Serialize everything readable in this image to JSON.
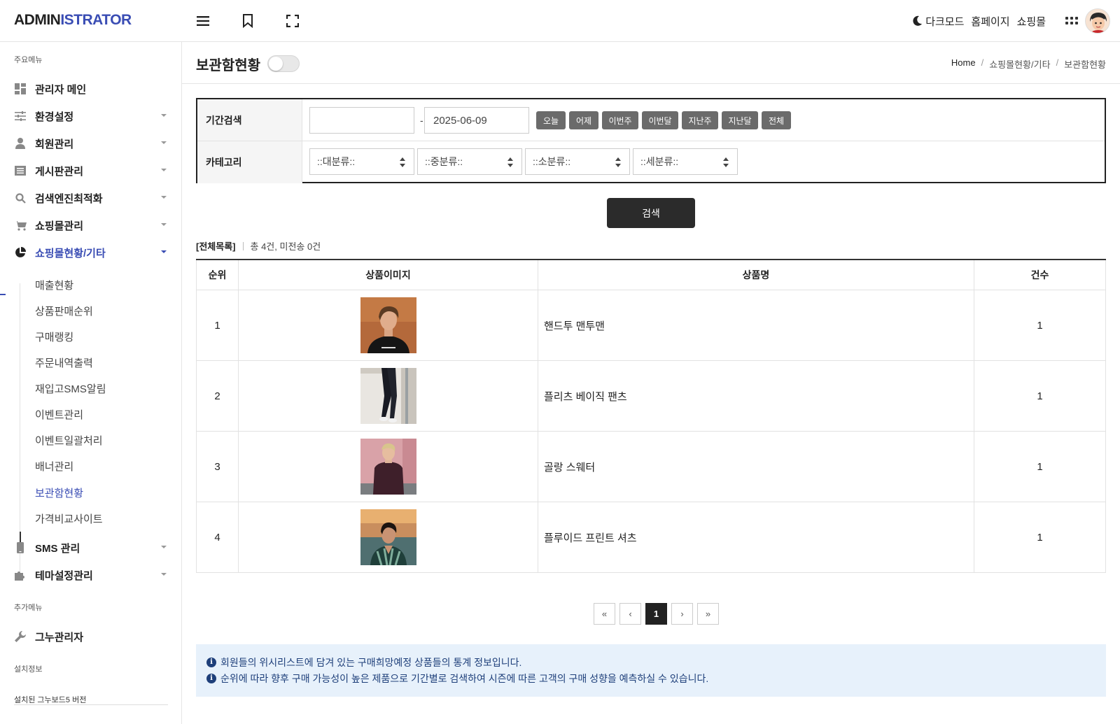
{
  "header": {
    "logo_main": "ADMIN",
    "logo_accent": "ISTRATOR",
    "dark_mode": "다크모드",
    "homepage": "홈페이지",
    "shop": "쇼핑몰"
  },
  "sidebar": {
    "main_section": "주요메뉴",
    "items": [
      {
        "label": "관리자 메인",
        "icon": "dashboard-icon"
      },
      {
        "label": "환경설정",
        "icon": "sliders-icon"
      },
      {
        "label": "회원관리",
        "icon": "user-icon"
      },
      {
        "label": "게시판관리",
        "icon": "board-icon"
      },
      {
        "label": "검색엔진최적화",
        "icon": "search-icon"
      },
      {
        "label": "쇼핑몰관리",
        "icon": "cart-icon"
      },
      {
        "label": "쇼핑몰현황/기타",
        "icon": "pie-chart-icon"
      }
    ],
    "sub_items": [
      "매출현황",
      "상품판매순위",
      "구매랭킹",
      "주문내역출력",
      "재입고SMS알림",
      "이벤트관리",
      "이벤트일괄처리",
      "배너관리",
      "보관함현황",
      "가격비교사이트"
    ],
    "items_after": [
      {
        "label": "SMS 관리",
        "icon": "mobile-icon"
      },
      {
        "label": "테마설정관리",
        "icon": "puzzle-icon"
      }
    ],
    "extra_section": "추가메뉴",
    "extra_items": [
      {
        "label": "그누관리자",
        "icon": "wrench-icon"
      }
    ],
    "install_section": "설치정보",
    "install_version": "설치된 그누보드5 버전"
  },
  "main": {
    "page_title": "보관함현황",
    "breadcrumb": [
      "Home",
      "쇼핑몰현황/기타",
      "보관함현황"
    ],
    "search": {
      "period_label": "기간검색",
      "date_from": "",
      "date_to": "2025-06-09",
      "dash": "-",
      "quick_buttons": [
        "오늘",
        "어제",
        "이번주",
        "이번달",
        "지난주",
        "지난달",
        "전체"
      ],
      "category_label": "카테고리",
      "categories": [
        "::대분류::",
        "::중분류::",
        "::소분류::",
        "::세분류::"
      ],
      "submit": "검색"
    },
    "summary": {
      "all_list": "[전체목록]",
      "count": "총 4건, 미전송 0건"
    },
    "table": {
      "headers": [
        "순위",
        "상품이미지",
        "상품명",
        "건수"
      ],
      "rows": [
        {
          "rank": "1",
          "name": "핸드투 맨투맨",
          "count": "1"
        },
        {
          "rank": "2",
          "name": "플리츠 베이직 팬츠",
          "count": "1"
        },
        {
          "rank": "3",
          "name": "골랑 스웨터",
          "count": "1"
        },
        {
          "rank": "4",
          "name": "플루이드 프린트 셔츠",
          "count": "1"
        }
      ]
    },
    "pagination": {
      "first": "«",
      "prev": "‹",
      "current": "1",
      "next": "›",
      "last": "»"
    },
    "info": [
      "회원들의 위시리스트에 담겨 있는 구매희망예정 상품들의 통계 정보입니다.",
      "순위에 따라 향후 구매 가능성이 높은 제품으로 기간별로 검색하여 시즌에 따른 고객의 구매 성향을 예측하실 수 있습니다."
    ]
  },
  "colors": {
    "accent": "#3a4db4",
    "info_bg": "#e7f1fb",
    "info_text": "#1e3f7a",
    "button_dark": "#2b2b2b",
    "quick_button": "#6b6b6b"
  }
}
